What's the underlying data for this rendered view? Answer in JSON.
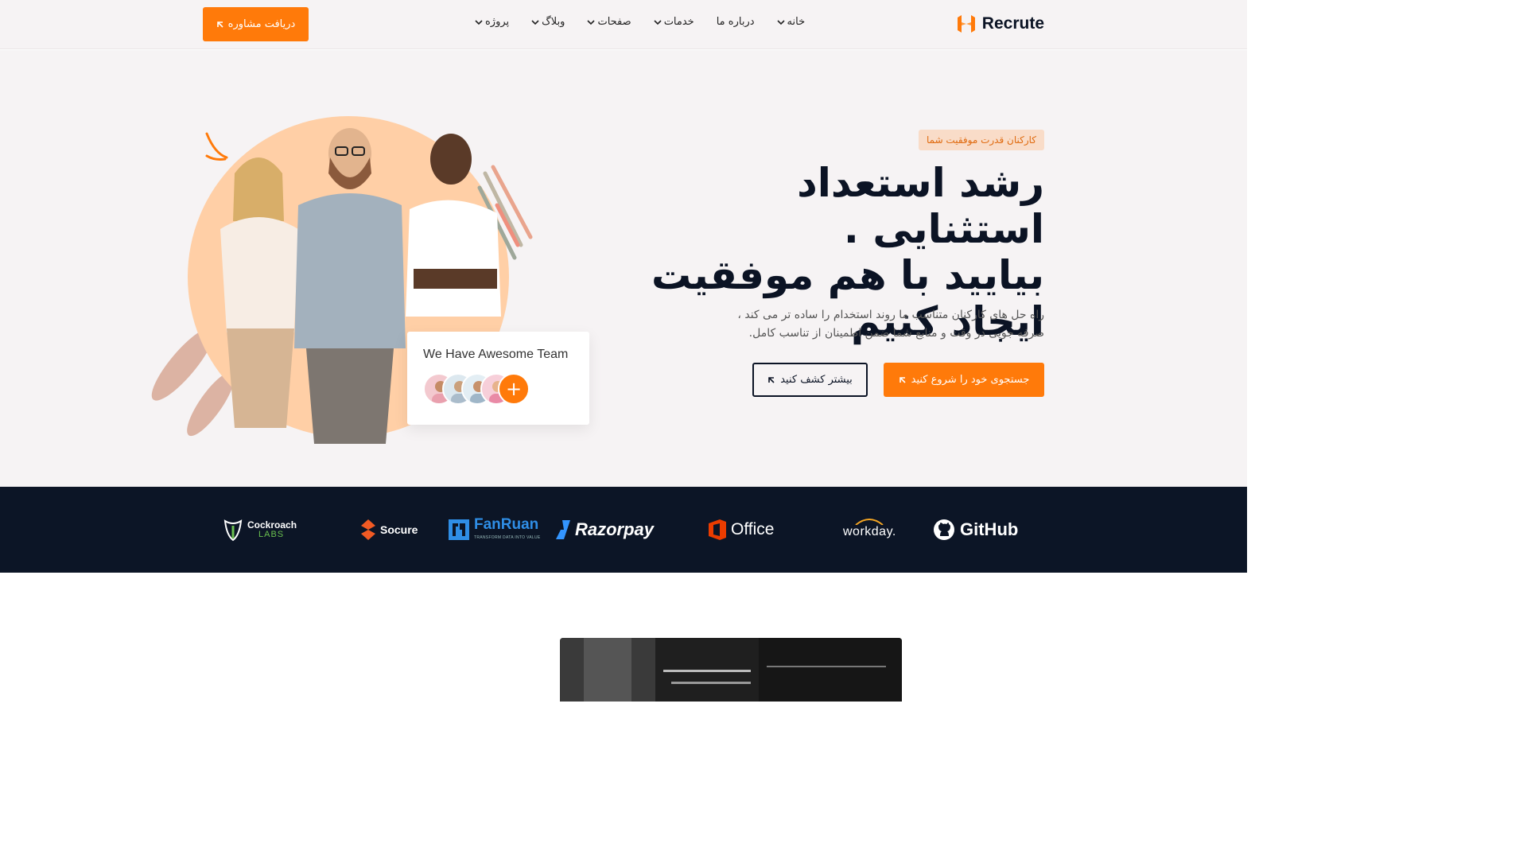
{
  "header": {
    "logo_text": "Recrute",
    "nav": [
      {
        "label": "خانه",
        "has_dropdown": true
      },
      {
        "label": "درباره ما",
        "has_dropdown": false
      },
      {
        "label": "خدمات",
        "has_dropdown": true
      },
      {
        "label": "صفحات",
        "has_dropdown": true
      },
      {
        "label": "وبلاگ",
        "has_dropdown": true
      },
      {
        "label": "پروژه",
        "has_dropdown": true
      }
    ],
    "cta_label": "دریافت مشاوره"
  },
  "hero": {
    "badge": "کارکنان قدرت موفقیت شما",
    "headline_lines": [
      "رشد استعداد استثنایی .",
      "بیایید با هم موفقیت",
      "ایجاد کنیم"
    ],
    "subtext_lines": [
      "راه حل های کارکنان متناسب ما روند استخدام را ساده تر می کند ،",
      "صرفه جویی در وقت و منابع شما ضمن اطمینان از تناسب کامل."
    ],
    "primary_button": "جستجوی خود را شروع کنید",
    "secondary_button": "بیشتر کشف کنید",
    "team_card_title": "We Have Awesome Team",
    "team_card_plus": "+"
  },
  "brands": [
    {
      "name": "Cockroach",
      "sub": "LABS",
      "icon": "cockroach-icon"
    },
    {
      "name": "Socure",
      "icon": "socure-icon"
    },
    {
      "name": "FanRuan",
      "sub": "TRANSFORM DATA INTO VALUE",
      "icon": "fanruan-icon"
    },
    {
      "name": "Razorpay",
      "icon": "razorpay-icon"
    },
    {
      "name": "Office",
      "icon": "office-icon"
    },
    {
      "name": "workday.",
      "icon": "workday-icon"
    },
    {
      "name": "GitHub",
      "icon": "github-icon"
    }
  ],
  "colors": {
    "accent": "#ff7a0a",
    "dark": "#0c1526",
    "hero_bg": "#f6f3f4",
    "badge_bg": "#f9dcc8"
  }
}
